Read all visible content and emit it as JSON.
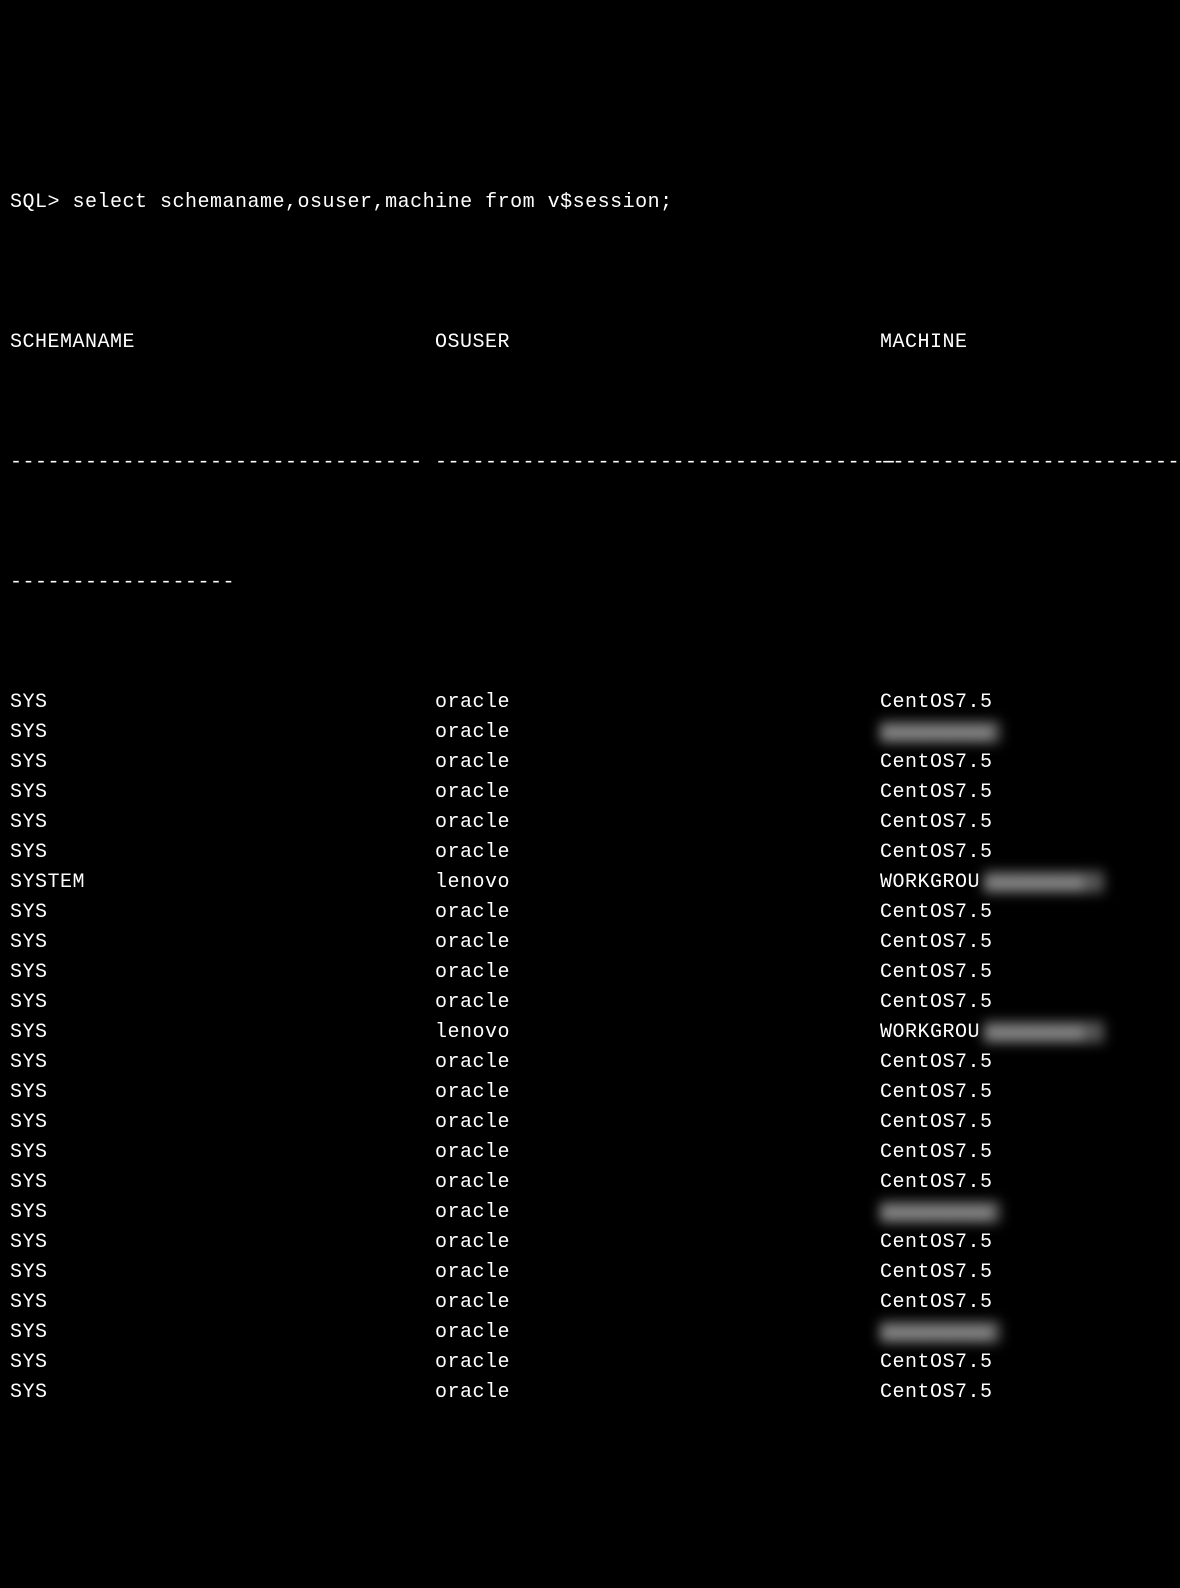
{
  "prompt": "SQL> ",
  "command": "select schemaname,osuser,machine from v$session;",
  "headers": {
    "col1": "SCHEMANAME",
    "col2": "OSUSER",
    "col3": "MACHINE"
  },
  "dash1": "---------------------------------",
  "dash2": "-------------------------------------",
  "dash3": "--------------------------",
  "dash_continue": "------------------",
  "rows": [
    {
      "schemaname": "SYS",
      "osuser": "oracle",
      "machine": "CentOS7.5",
      "redacted": false
    },
    {
      "schemaname": "SYS",
      "osuser": "oracle",
      "machine": "",
      "redacted": true
    },
    {
      "schemaname": "SYS",
      "osuser": "oracle",
      "machine": "CentOS7.5",
      "redacted": false
    },
    {
      "schemaname": "SYS",
      "osuser": "oracle",
      "machine": "CentOS7.5",
      "redacted": false
    },
    {
      "schemaname": "SYS",
      "osuser": "oracle",
      "machine": "CentOS7.5",
      "redacted": false
    },
    {
      "schemaname": "SYS",
      "osuser": "oracle",
      "machine": "CentOS7.5",
      "redacted": false
    },
    {
      "schemaname": "SYSTEM",
      "osuser": "lenovo",
      "machine": "WORKGROU",
      "redacted": "partial"
    },
    {
      "schemaname": "SYS",
      "osuser": "oracle",
      "machine": "CentOS7.5",
      "redacted": false
    },
    {
      "schemaname": "SYS",
      "osuser": "oracle",
      "machine": "CentOS7.5",
      "redacted": false
    },
    {
      "schemaname": "SYS",
      "osuser": "oracle",
      "machine": "CentOS7.5",
      "redacted": false
    },
    {
      "schemaname": "SYS",
      "osuser": "oracle",
      "machine": "CentOS7.5",
      "redacted": false
    },
    {
      "schemaname": "SYS",
      "osuser": "lenovo",
      "machine": "WORKGROU",
      "redacted": "partial"
    },
    {
      "schemaname": "SYS",
      "osuser": "oracle",
      "machine": "CentOS7.5",
      "redacted": false
    },
    {
      "schemaname": "SYS",
      "osuser": "oracle",
      "machine": "CentOS7.5",
      "redacted": false
    },
    {
      "schemaname": "SYS",
      "osuser": "oracle",
      "machine": "CentOS7.5",
      "redacted": false
    },
    {
      "schemaname": "SYS",
      "osuser": "oracle",
      "machine": "CentOS7.5",
      "redacted": false
    },
    {
      "schemaname": "SYS",
      "osuser": "oracle",
      "machine": "CentOS7.5",
      "redacted": false
    },
    {
      "schemaname": "SYS",
      "osuser": "oracle",
      "machine": "",
      "redacted": true
    },
    {
      "schemaname": "SYS",
      "osuser": "oracle",
      "machine": "CentOS7.5",
      "redacted": false
    },
    {
      "schemaname": "SYS",
      "osuser": "oracle",
      "machine": "CentOS7.5",
      "redacted": false
    },
    {
      "schemaname": "SYS",
      "osuser": "oracle",
      "machine": "CentOS7.5",
      "redacted": false
    },
    {
      "schemaname": "SYS",
      "osuser": "oracle",
      "machine": "",
      "redacted": true
    },
    {
      "schemaname": "SYS",
      "osuser": "oracle",
      "machine": "CentOS7.5",
      "redacted": false
    },
    {
      "schemaname": "SYS",
      "osuser": "oracle",
      "machine": "CentOS7.5",
      "redacted": false
    }
  ]
}
